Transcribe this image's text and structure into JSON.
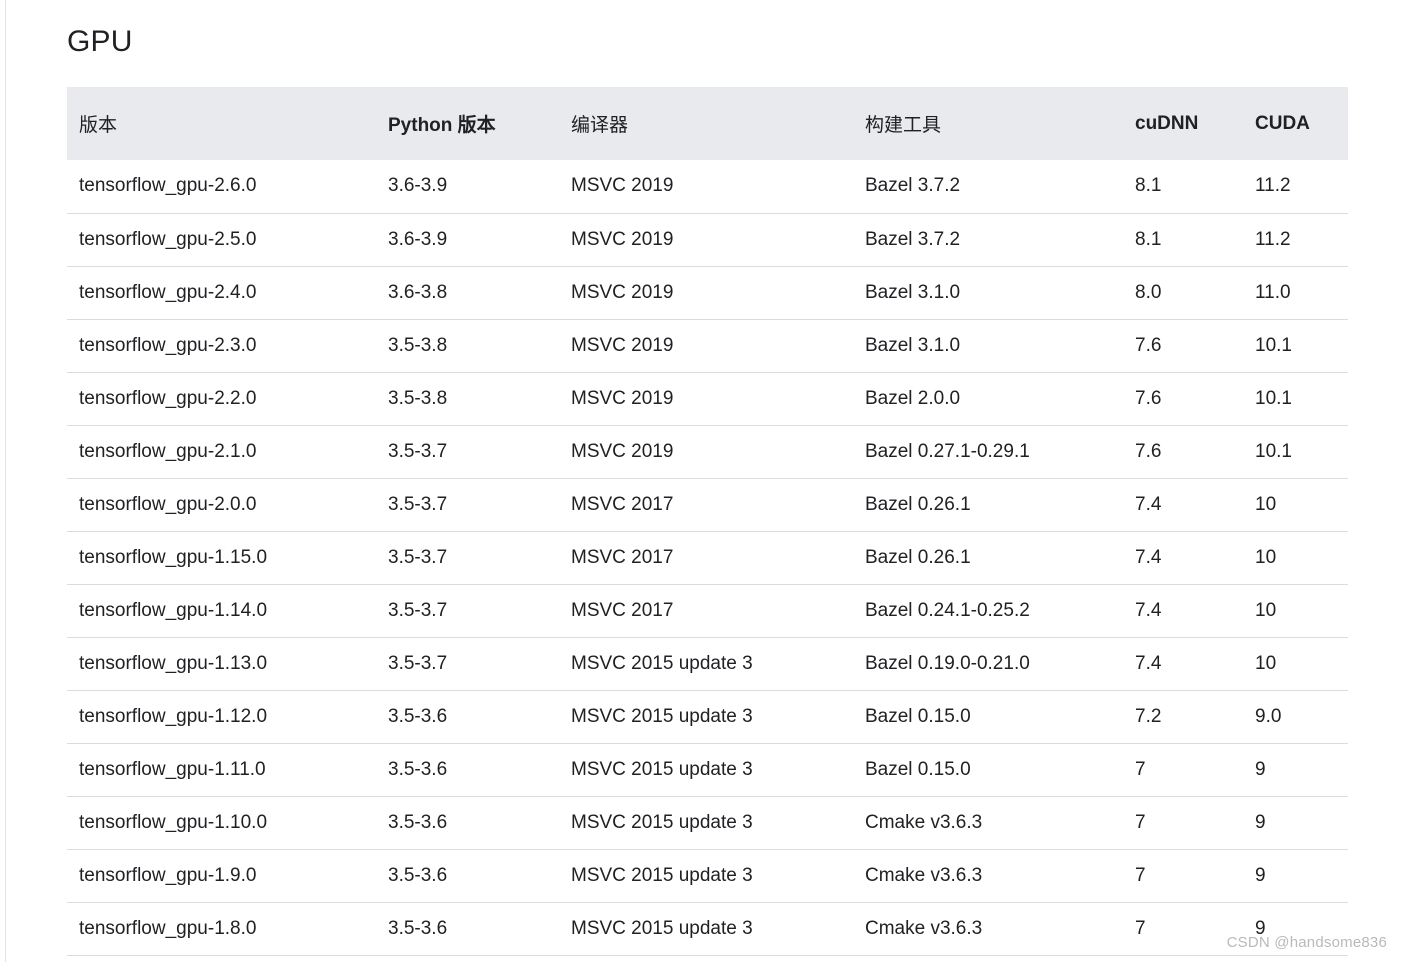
{
  "heading": "GPU",
  "columns": [
    "版本",
    "Python 版本",
    "编译器",
    "构建工具",
    "cuDNN",
    "CUDA"
  ],
  "rows": [
    [
      "tensorflow_gpu-2.6.0",
      "3.6-3.9",
      "MSVC 2019",
      "Bazel 3.7.2",
      "8.1",
      "11.2"
    ],
    [
      "tensorflow_gpu-2.5.0",
      "3.6-3.9",
      "MSVC 2019",
      "Bazel 3.7.2",
      "8.1",
      "11.2"
    ],
    [
      "tensorflow_gpu-2.4.0",
      "3.6-3.8",
      "MSVC 2019",
      "Bazel 3.1.0",
      "8.0",
      "11.0"
    ],
    [
      "tensorflow_gpu-2.3.0",
      "3.5-3.8",
      "MSVC 2019",
      "Bazel 3.1.0",
      "7.6",
      "10.1"
    ],
    [
      "tensorflow_gpu-2.2.0",
      "3.5-3.8",
      "MSVC 2019",
      "Bazel 2.0.0",
      "7.6",
      "10.1"
    ],
    [
      "tensorflow_gpu-2.1.0",
      "3.5-3.7",
      "MSVC 2019",
      "Bazel 0.27.1-0.29.1",
      "7.6",
      "10.1"
    ],
    [
      "tensorflow_gpu-2.0.0",
      "3.5-3.7",
      "MSVC 2017",
      "Bazel 0.26.1",
      "7.4",
      "10"
    ],
    [
      "tensorflow_gpu-1.15.0",
      "3.5-3.7",
      "MSVC 2017",
      "Bazel 0.26.1",
      "7.4",
      "10"
    ],
    [
      "tensorflow_gpu-1.14.0",
      "3.5-3.7",
      "MSVC 2017",
      "Bazel 0.24.1-0.25.2",
      "7.4",
      "10"
    ],
    [
      "tensorflow_gpu-1.13.0",
      "3.5-3.7",
      "MSVC 2015 update 3",
      "Bazel 0.19.0-0.21.0",
      "7.4",
      "10"
    ],
    [
      "tensorflow_gpu-1.12.0",
      "3.5-3.6",
      "MSVC 2015 update 3",
      "Bazel 0.15.0",
      "7.2",
      "9.0"
    ],
    [
      "tensorflow_gpu-1.11.0",
      "3.5-3.6",
      "MSVC 2015 update 3",
      "Bazel 0.15.0",
      "7",
      "9"
    ],
    [
      "tensorflow_gpu-1.10.0",
      "3.5-3.6",
      "MSVC 2015 update 3",
      "Cmake v3.6.3",
      "7",
      "9"
    ],
    [
      "tensorflow_gpu-1.9.0",
      "3.5-3.6",
      "MSVC 2015 update 3",
      "Cmake v3.6.3",
      "7",
      "9"
    ],
    [
      "tensorflow_gpu-1.8.0",
      "3.5-3.6",
      "MSVC 2015 update 3",
      "Cmake v3.6.3",
      "7",
      "9"
    ]
  ],
  "watermark": "CSDN @handsome836",
  "colors": {
    "header_bg": "#e8eaed",
    "row_divider": "#dadce0",
    "text": "#202124",
    "watermark": "#b9b9b9"
  }
}
